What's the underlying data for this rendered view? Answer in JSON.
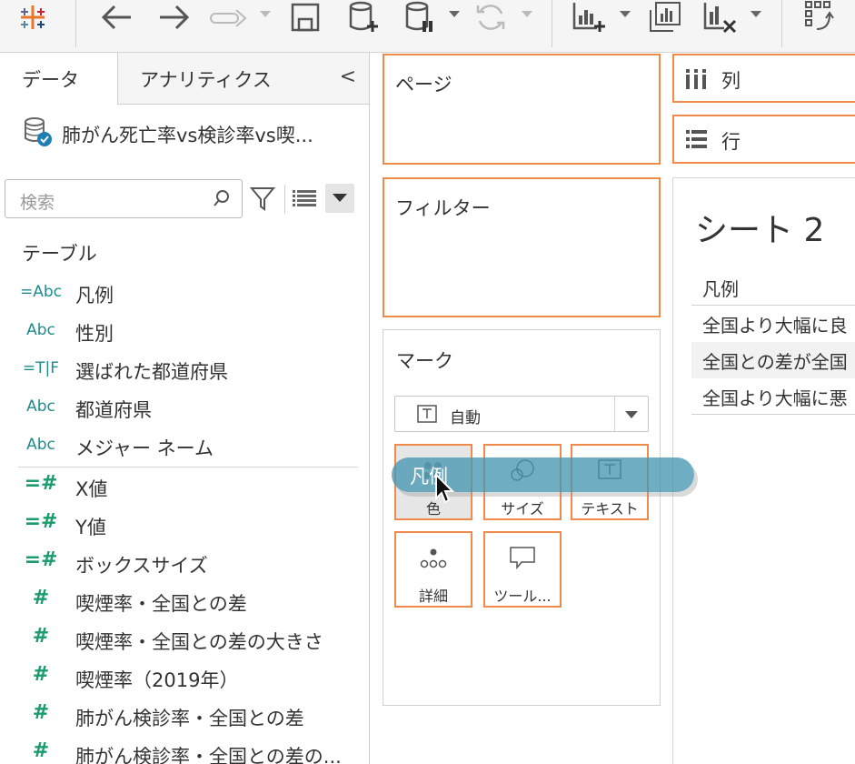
{
  "toolbar": {
    "items": [
      "tableau-logo-icon",
      "back-icon",
      "forward-icon",
      "redo-icon",
      "save-icon",
      "new-datasource-icon",
      "pause-datasource-icon",
      "refresh-icon",
      "new-worksheet-icon",
      "duplicate-sheet-icon",
      "clear-sheet-icon",
      "swap-icon"
    ]
  },
  "data_pane": {
    "tab_data": "データ",
    "tab_analytics": "アナリティクス",
    "collapse_glyph": "<",
    "datasource_name": "肺がん死亡率vs検診率vs喫...",
    "search_placeholder": "検索",
    "tables_heading": "テーブル",
    "fields": [
      {
        "icon": "=Abc",
        "label": "凡例",
        "kind": "dimension-calc"
      },
      {
        "icon": "Abc",
        "label": "性別",
        "kind": "dimension"
      },
      {
        "icon": "=T|F",
        "label": "選ばれた都道府県",
        "kind": "boolean-calc"
      },
      {
        "icon": "Abc",
        "label": "都道府県",
        "kind": "dimension"
      },
      {
        "icon": "Abc",
        "label": "メジャー ネーム",
        "kind": "dimension"
      },
      {
        "icon": "=#",
        "label": "X値",
        "kind": "measure-calc"
      },
      {
        "icon": "=#",
        "label": "Y値",
        "kind": "measure-calc"
      },
      {
        "icon": "=#",
        "label": "ボックスサイズ",
        "kind": "measure-calc"
      },
      {
        "icon": "#",
        "label": "喫煙率・全国との差",
        "kind": "measure"
      },
      {
        "icon": "#",
        "label": "喫煙率・全国との差の大きさ",
        "kind": "measure"
      },
      {
        "icon": "#",
        "label": "喫煙率（2019年）",
        "kind": "measure"
      },
      {
        "icon": "#",
        "label": "肺がん検診率・全国との差",
        "kind": "measure"
      },
      {
        "icon": "#",
        "label": "肺がん検診率・全国との差の...",
        "kind": "measure"
      }
    ]
  },
  "shelves": {
    "pages": "ページ",
    "filters": "フィルター",
    "columns": "列",
    "rows": "行"
  },
  "marks": {
    "title": "マーク",
    "mark_type": "自動",
    "buttons": {
      "color": "色",
      "size": "サイズ",
      "text": "テキスト",
      "detail": "詳細",
      "tooltip": "ツール..."
    }
  },
  "sheet": {
    "title": "シート 2",
    "legend_header": "凡例",
    "legend_rows": [
      "全国より大幅に良",
      "全国との差が全国",
      "全国より大幅に悪"
    ]
  },
  "drag": {
    "label": "凡例"
  },
  "colors": {
    "accent_orange": "#f08a4b",
    "dimension_teal": "#1f8b8d",
    "measure_green": "#1a9c6c",
    "pill_blue": "#4696b2"
  }
}
